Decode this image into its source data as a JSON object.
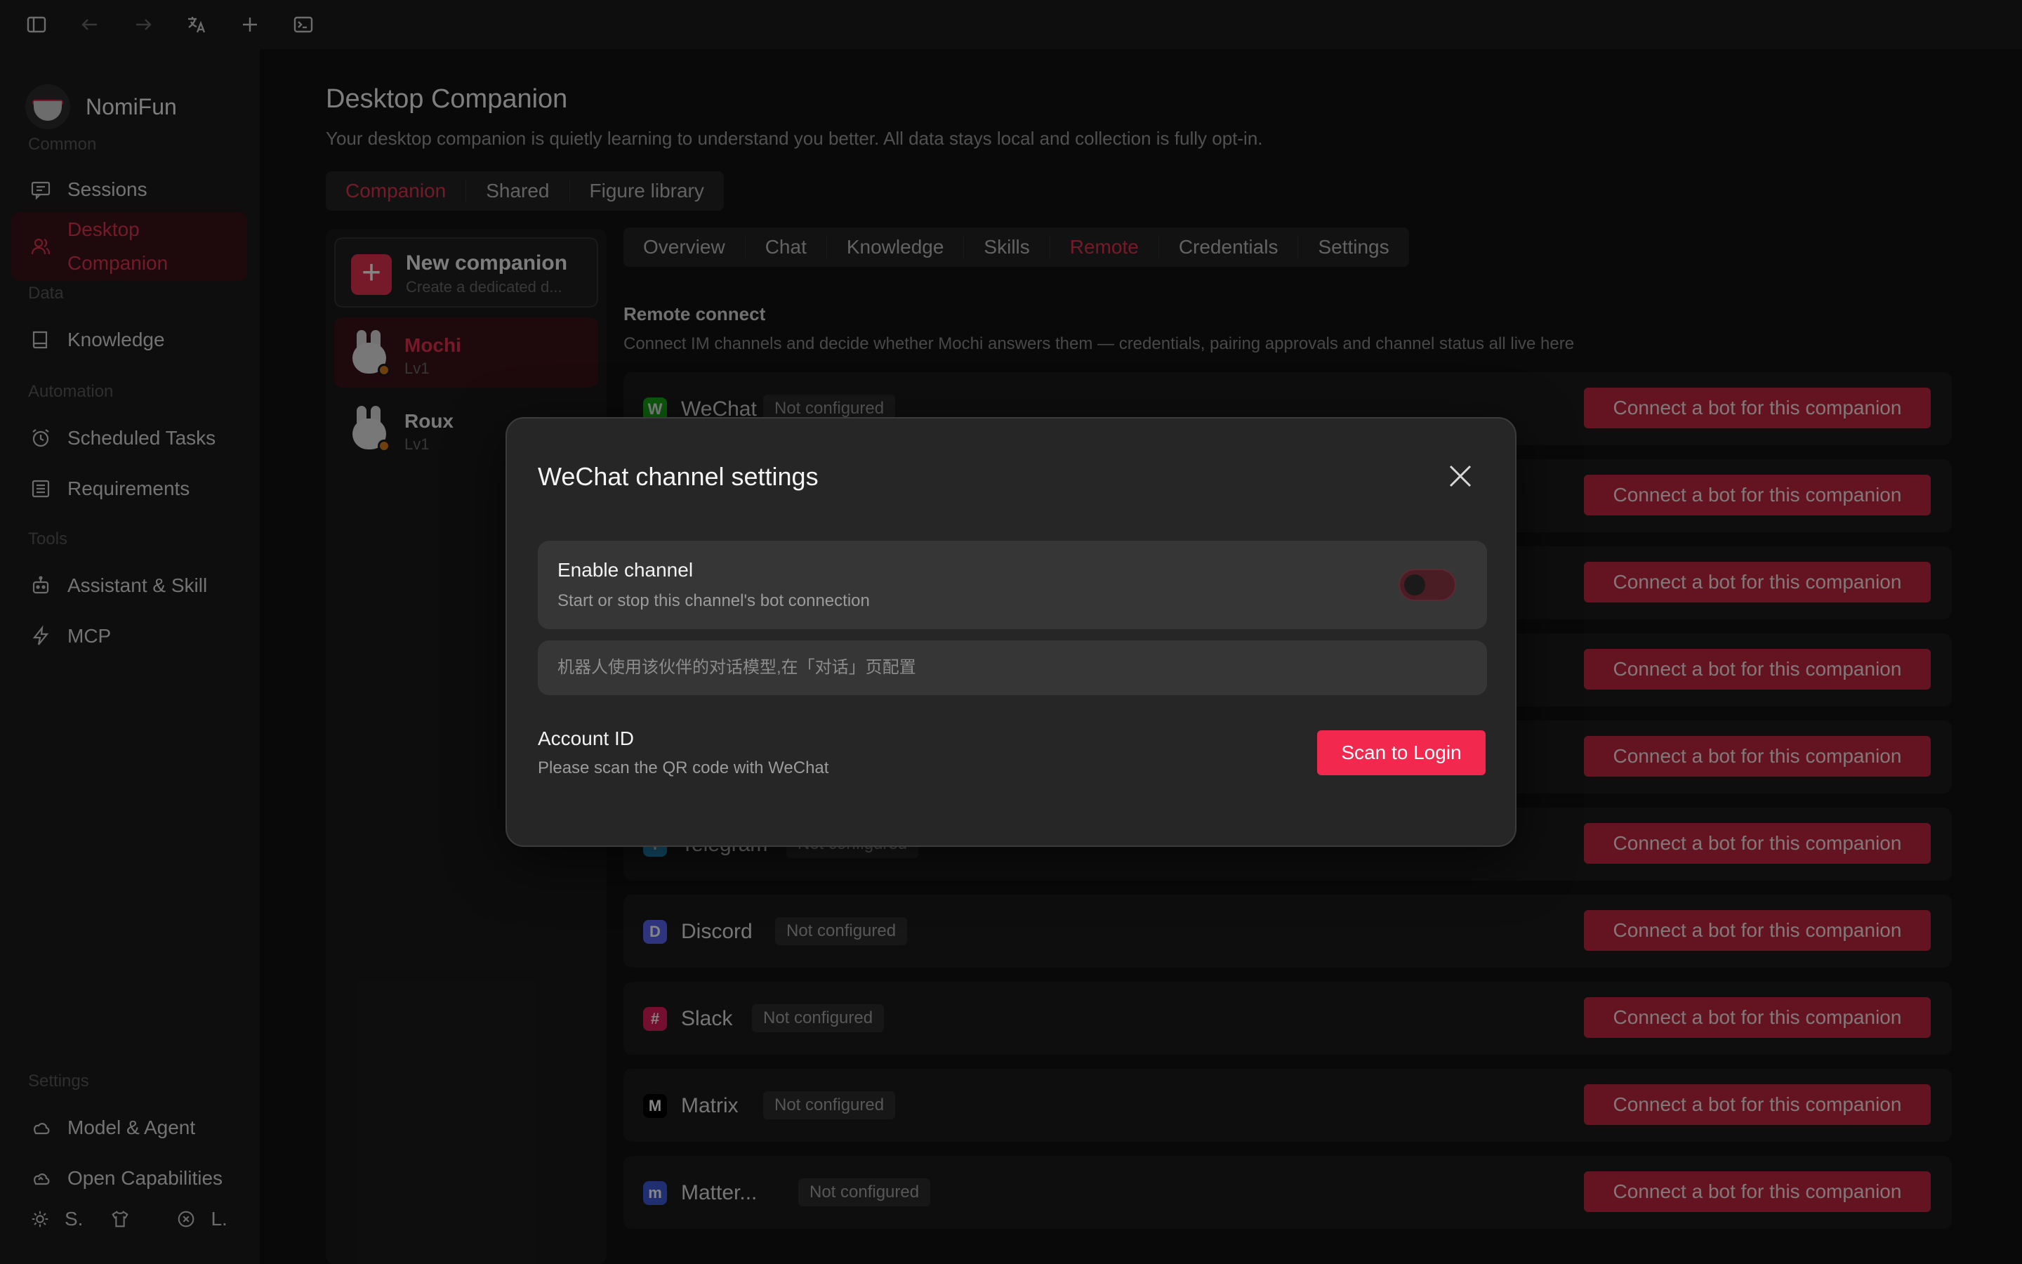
{
  "app": {
    "name": "NomiFun"
  },
  "sidebar": {
    "sections": [
      "Common",
      "Data",
      "Automation",
      "Tools",
      "Settings"
    ],
    "items": [
      {
        "label": "Sessions"
      },
      {
        "label": "Desktop Companion"
      },
      {
        "label": "Knowledge"
      },
      {
        "label": "Scheduled Tasks"
      },
      {
        "label": "Requirements"
      },
      {
        "label": "Assistant & Skill"
      },
      {
        "label": "MCP"
      },
      {
        "label": "Model & Agent"
      },
      {
        "label": "Open Capabilities"
      }
    ],
    "bottom": {
      "left": "S.",
      "right": "L."
    }
  },
  "main": {
    "title": "Desktop Companion",
    "subtitle": "Your desktop companion is quietly learning to understand you better. All data stays local and collection is fully opt-in.",
    "tabs": [
      "Companion",
      "Shared",
      "Figure library"
    ],
    "new_companion": {
      "title": "New companion",
      "subtitle": "Create a dedicated d..."
    },
    "companions": [
      {
        "name": "Mochi",
        "level": "Lv1"
      },
      {
        "name": "Roux",
        "level": "Lv1"
      }
    ],
    "sub_tabs": [
      "Overview",
      "Chat",
      "Knowledge",
      "Skills",
      "Remote",
      "Credentials",
      "Settings"
    ],
    "remote": {
      "title": "Remote connect",
      "subtitle": "Connect IM channels and decide whether Mochi answers them — credentials, pairing approvals and channel status all live here"
    },
    "connect_label": "Connect a bot for this companion",
    "channels": [
      {
        "name": "WeChat",
        "status": "Not configured",
        "color": "#1aad19",
        "glyph": "W"
      },
      {
        "name": "",
        "status": "",
        "color": "#333333",
        "glyph": ""
      },
      {
        "name": "",
        "status": "",
        "color": "#333333",
        "glyph": ""
      },
      {
        "name": "",
        "status": "",
        "color": "#333333",
        "glyph": ""
      },
      {
        "name": "",
        "status": "",
        "color": "#333333",
        "glyph": ""
      },
      {
        "name": "Telegram",
        "status": "Not configured",
        "color": "#2aa1da",
        "glyph": "T"
      },
      {
        "name": "Discord",
        "status": "Not configured",
        "color": "#5865f2",
        "glyph": "D"
      },
      {
        "name": "Slack",
        "status": "Not configured",
        "color": "#e01e5a",
        "glyph": "#"
      },
      {
        "name": "Matrix",
        "status": "Not configured",
        "color": "#000000",
        "glyph": "M"
      },
      {
        "name": "Matter...",
        "status": "Not configured",
        "color": "#3d5bd9",
        "glyph": "m"
      }
    ]
  },
  "modal": {
    "title": "WeChat channel settings",
    "enable": {
      "title": "Enable channel",
      "subtitle": "Start or stop this channel's bot connection"
    },
    "model_placeholder": "机器人使用该伙伴的对话模型,在「对话」页配置",
    "account": {
      "title": "Account ID",
      "subtitle": "Please scan the QR code with WeChat"
    },
    "scan_button": "Scan to Login"
  },
  "colors": {
    "accent": "#f2284e",
    "accent_dark": "#c0283f"
  }
}
